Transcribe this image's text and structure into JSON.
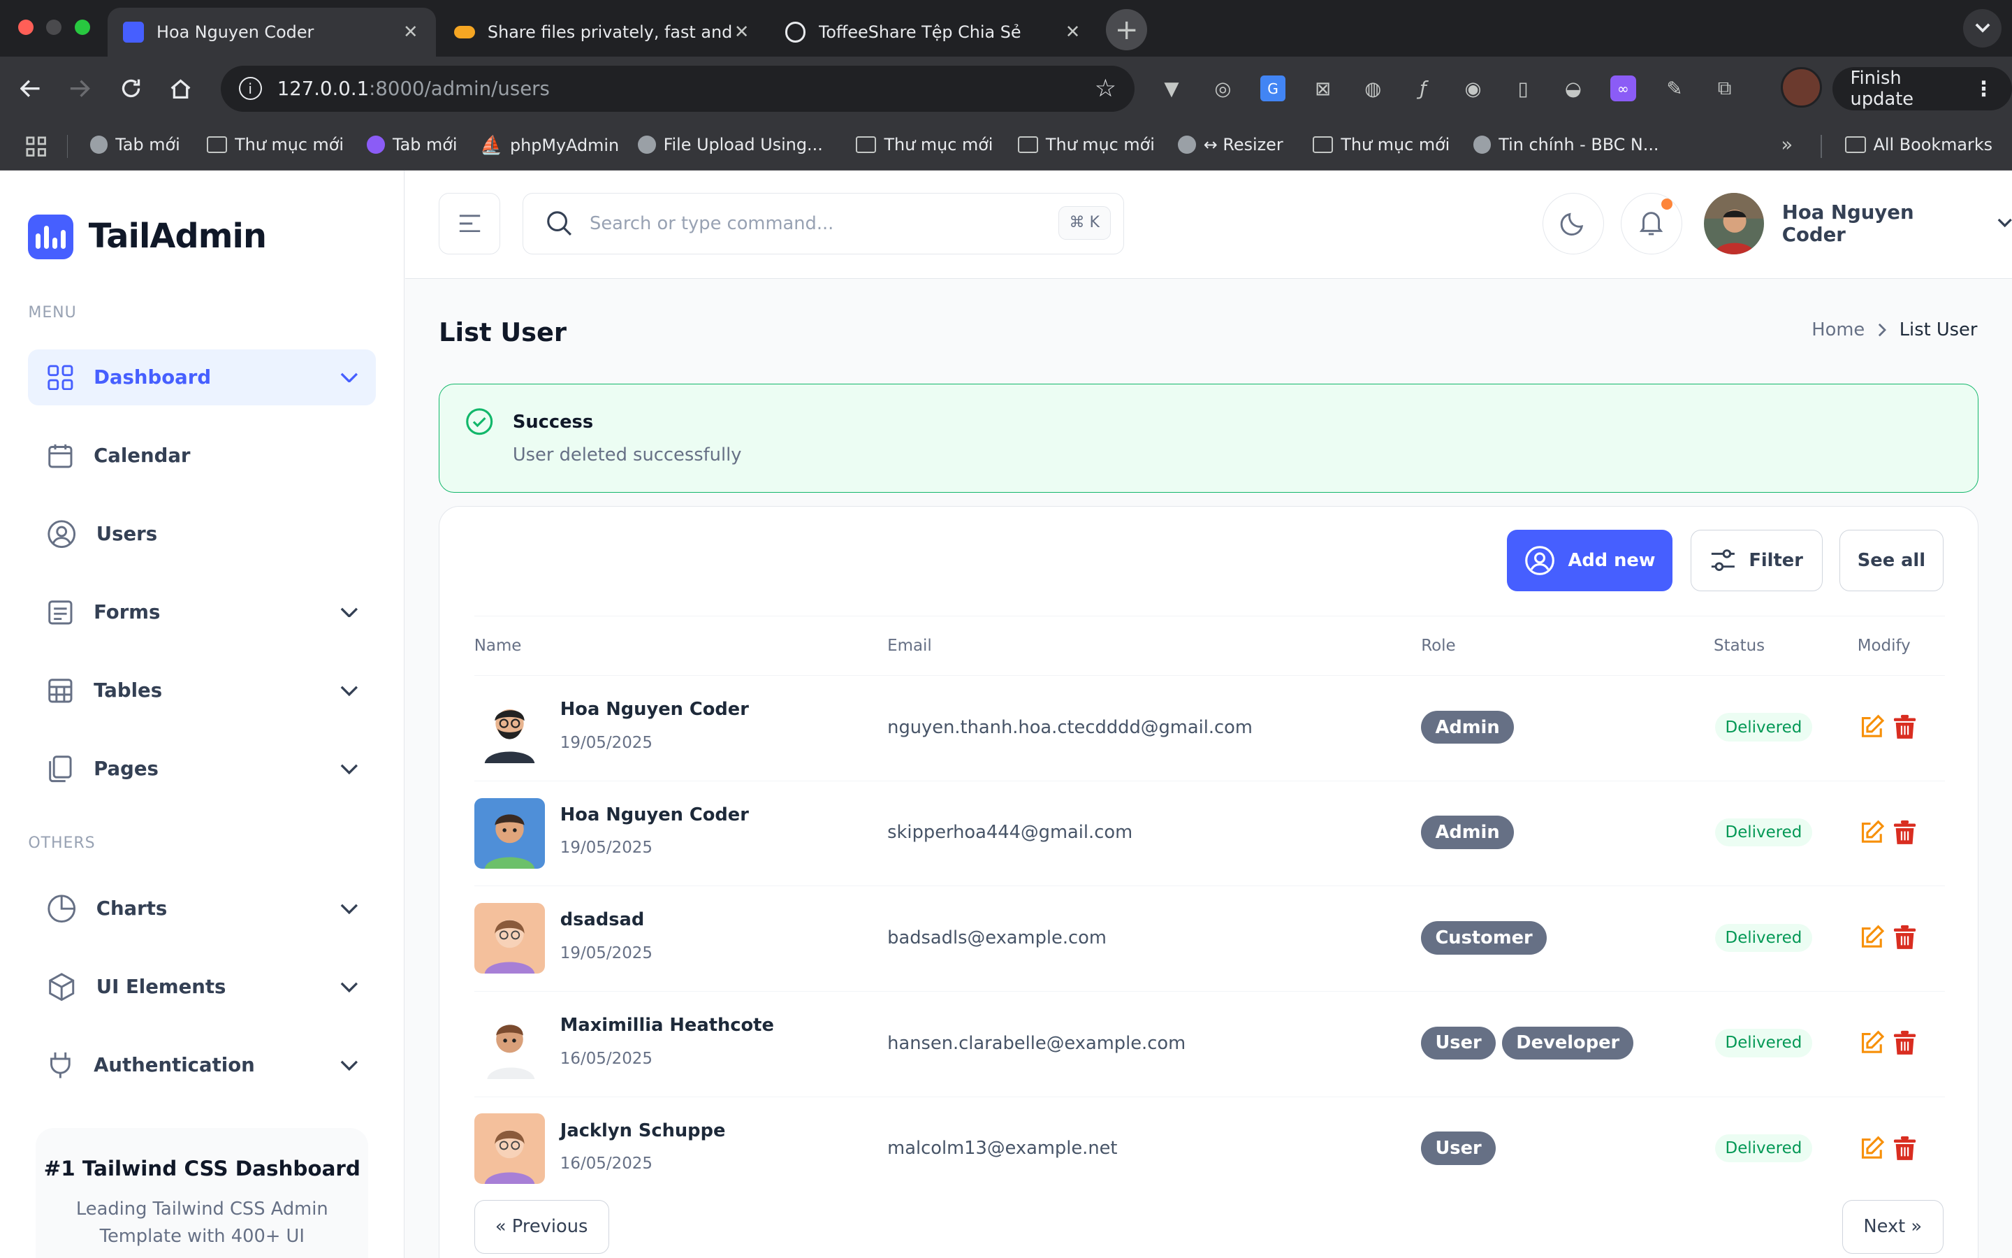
{
  "browser": {
    "tabs": [
      {
        "title": "Hoa Nguyen Coder",
        "active": true
      },
      {
        "title": "Share files privately, fast and",
        "active": false
      },
      {
        "title": "ToffeeShare Tệp Chia Sẻ",
        "active": false
      }
    ],
    "url_host": "127.0.0.1",
    "url_rest": ":8000/admin/users",
    "finish_update": "Finish update",
    "bookmarks": [
      "Tab mới",
      "Thư mục mới",
      "Tab mới",
      "phpMyAdmin",
      "File Upload Using...",
      "Thư mục mới",
      "Thư mục mới",
      "↔ Resizer",
      "Thư mục mới",
      "Tin chính - BBC N..."
    ],
    "all_bookmarks": "All Bookmarks"
  },
  "sidebar": {
    "logo": "TailAdmin",
    "menu_heading": "MENU",
    "others_heading": "OTHERS",
    "items": [
      {
        "label": "Dashboard",
        "icon": "grid-icon",
        "active": true,
        "chevron": true
      },
      {
        "label": "Calendar",
        "icon": "calendar-icon",
        "active": false,
        "chevron": false
      },
      {
        "label": "Users",
        "icon": "user-circle-icon",
        "active": false,
        "chevron": false
      },
      {
        "label": "Forms",
        "icon": "form-icon",
        "active": false,
        "chevron": true
      },
      {
        "label": "Tables",
        "icon": "table-icon",
        "active": false,
        "chevron": true
      },
      {
        "label": "Pages",
        "icon": "pages-icon",
        "active": false,
        "chevron": true
      }
    ],
    "others": [
      {
        "label": "Charts",
        "icon": "pie-chart-icon",
        "chevron": true
      },
      {
        "label": "UI Elements",
        "icon": "box-icon",
        "chevron": true
      },
      {
        "label": "Authentication",
        "icon": "plug-icon",
        "chevron": true
      }
    ],
    "promo": {
      "title": "#1 Tailwind CSS Dashboard",
      "text": "Leading Tailwind CSS Admin Template with 400+ UI"
    }
  },
  "header": {
    "search_placeholder": "Search or type command...",
    "shortcut": "⌘ K",
    "user_name": "Hoa Nguyen Coder"
  },
  "page": {
    "title": "List User",
    "breadcrumb_home": "Home",
    "breadcrumb_current": "List User"
  },
  "alert": {
    "title": "Success",
    "message": "User deleted successfully"
  },
  "toolbar": {
    "add_new": "Add new",
    "filter": "Filter",
    "see_all": "See all"
  },
  "table": {
    "columns": [
      "Name",
      "Email",
      "Role",
      "Status",
      "Modify"
    ],
    "rows": [
      {
        "name": "Hoa Nguyen Coder",
        "date": "19/05/2025",
        "email": "nguyen.thanh.hoa.ctecdddd@gmail.com",
        "roles": [
          "Admin"
        ],
        "status": "Delivered"
      },
      {
        "name": "Hoa Nguyen Coder",
        "date": "19/05/2025",
        "email": "skipperhoa444@gmail.com",
        "roles": [
          "Admin"
        ],
        "status": "Delivered"
      },
      {
        "name": "dsadsad",
        "date": "19/05/2025",
        "email": "badsadls@example.com",
        "roles": [
          "Customer"
        ],
        "status": "Delivered"
      },
      {
        "name": "Maximillia Heathcote",
        "date": "16/05/2025",
        "email": "hansen.clarabelle@example.com",
        "roles": [
          "User",
          "Developer"
        ],
        "status": "Delivered"
      },
      {
        "name": "Jacklyn Schuppe",
        "date": "16/05/2025",
        "email": "malcolm13@example.net",
        "roles": [
          "User"
        ],
        "status": "Delivered"
      }
    ]
  },
  "pagination": {
    "previous": "« Previous",
    "next": "Next »"
  },
  "colors": {
    "accent": "#465fff",
    "success": "#12b76a",
    "delete": "#d92d20",
    "edit": "#f79009"
  }
}
